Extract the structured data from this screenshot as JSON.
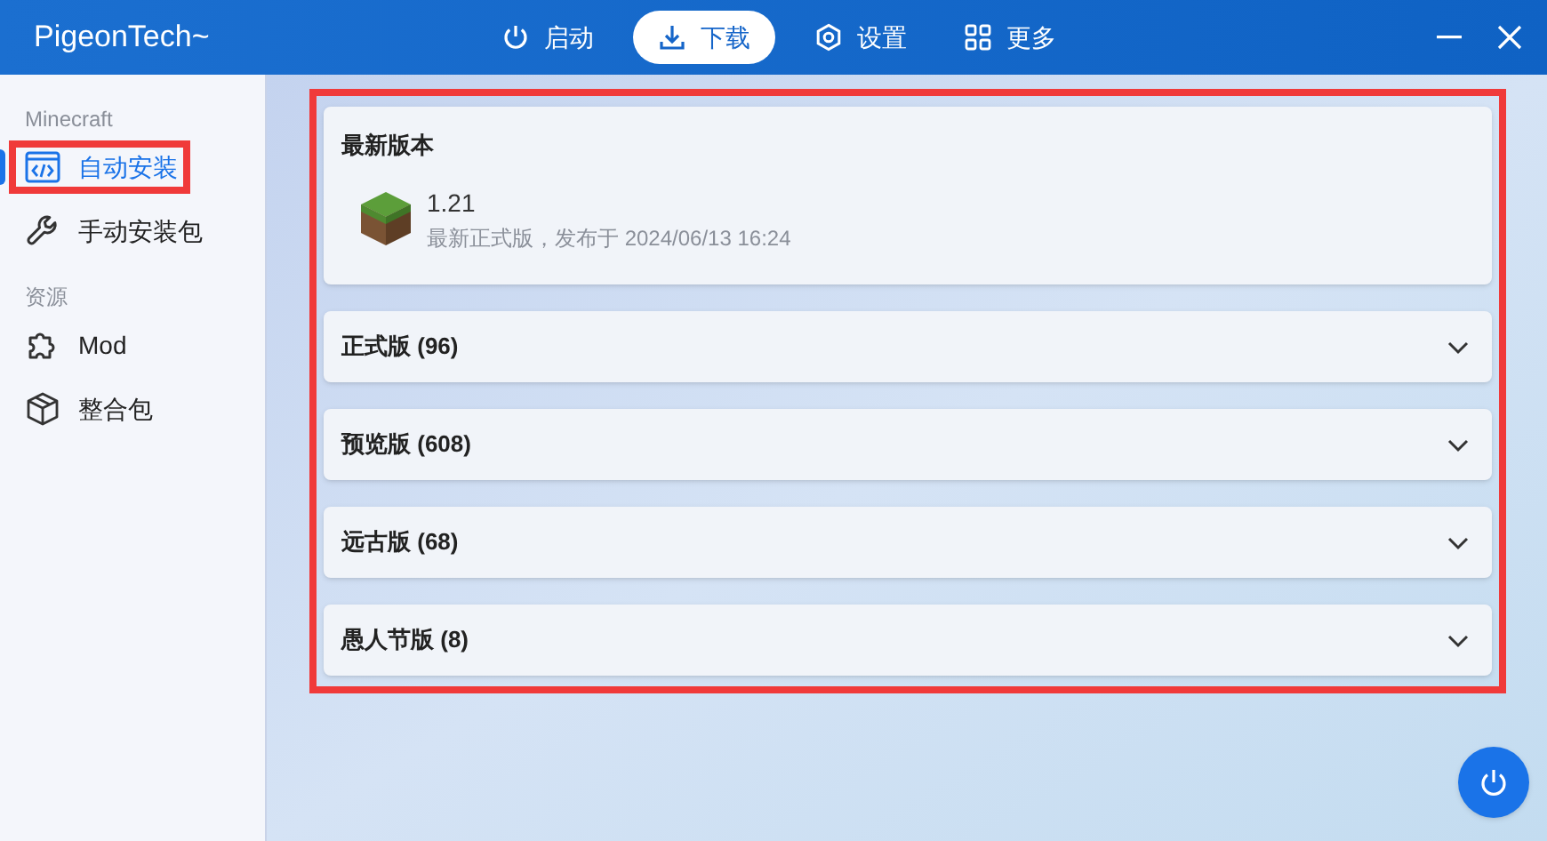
{
  "window": {
    "title": "PigeonTech~"
  },
  "nav_tabs": [
    {
      "label": "启动",
      "selected": false
    },
    {
      "label": "下载",
      "selected": true
    },
    {
      "label": "设置",
      "selected": false
    },
    {
      "label": "更多",
      "selected": false
    }
  ],
  "sidebar": {
    "sections": [
      {
        "heading": "Minecraft",
        "items": [
          {
            "label": "自动安装",
            "selected": true,
            "highlighted": true
          },
          {
            "label": "手动安装包",
            "selected": false,
            "highlighted": false
          }
        ]
      },
      {
        "heading": "资源",
        "items": [
          {
            "label": "Mod",
            "selected": false,
            "highlighted": false
          },
          {
            "label": "整合包",
            "selected": false,
            "highlighted": false
          }
        ]
      }
    ]
  },
  "content": {
    "highlighted": true,
    "latest": {
      "heading": "最新版本",
      "version": "1.21",
      "detail": "最新正式版，发布于 2024/06/13 16:24"
    },
    "groups": [
      {
        "label": "正式版 (96)",
        "expanded": false
      },
      {
        "label": "预览版 (608)",
        "expanded": false
      },
      {
        "label": "远古版 (68)",
        "expanded": false
      },
      {
        "label": "愚人节版 (8)",
        "expanded": false
      }
    ]
  }
}
